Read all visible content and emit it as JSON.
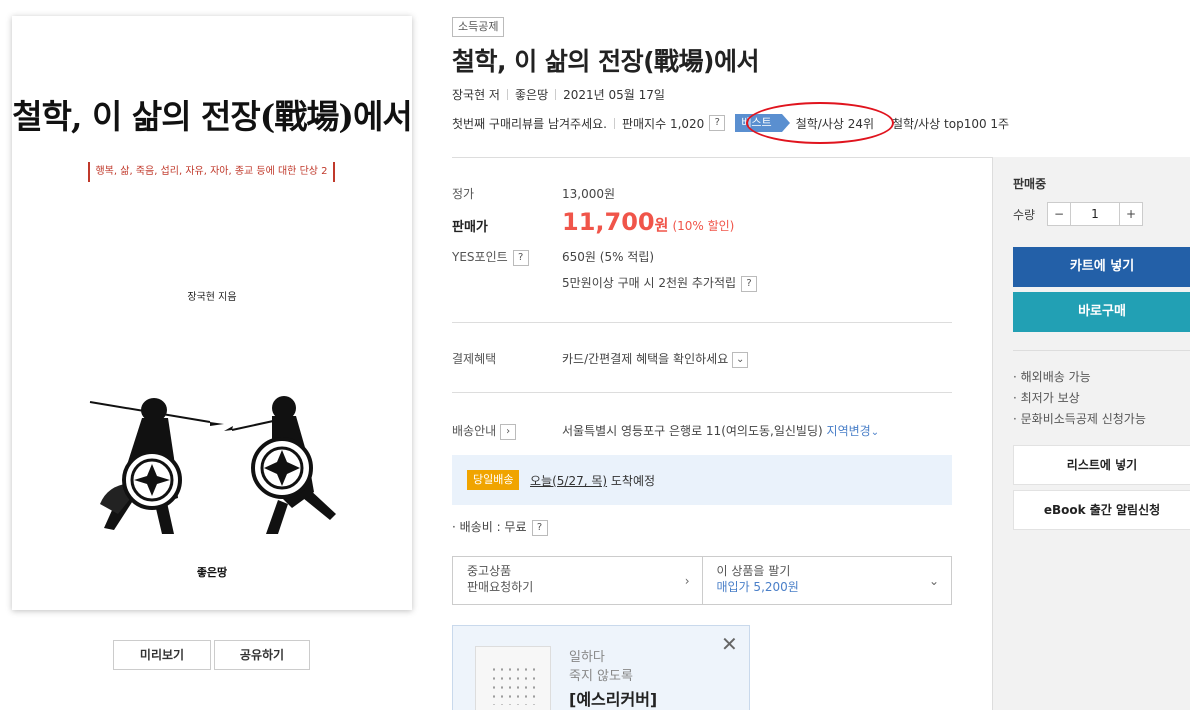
{
  "cover": {
    "title": "철학, 이 삶의 전장(戰場)에서",
    "subtitle": "행복, 삶, 죽음, 섭리, 자유, 자아, 종교 등에 대한 단상 2",
    "author": "장국현 지음",
    "publisher": "좋은땅",
    "preview_label": "미리보기",
    "share_label": "공유하기"
  },
  "product": {
    "tag": "소득공제",
    "title": "철학, 이 삶의 전장(戰場)에서",
    "author": "장국현 저",
    "publisher": "좋은땅",
    "date": "2021년 05월 17일",
    "review_prompt": "첫번째 구매리뷰를 남겨주세요.",
    "sales_index": "판매지수 1,020",
    "best_badge": "베스트",
    "best_rank": "철학/사상 24위",
    "top100": "철학/사상 top100 1주"
  },
  "pricing": {
    "list_label": "정가",
    "list_price": "13,000원",
    "sale_label": "판매가",
    "sale_price": "11,700",
    "sale_unit": "원",
    "discount": "(10% 할인)",
    "points_label": "YES포인트",
    "points": "650원 (5% 적립)",
    "points_extra": "5만원이상 구매 시 2천원 추가적립"
  },
  "payment": {
    "label": "결제혜택",
    "value": "카드/간편결제 혜택을 확인하세요"
  },
  "shipping": {
    "label": "배송안내",
    "address": "서울특별시 영등포구 은행로 11(여의도동,일신빌딩)",
    "change_region": "지역변경",
    "sameday_badge": "당일배송",
    "sameday_date": "오늘(5/27, 목)",
    "sameday_suffix": "도착예정",
    "fee": "· 배송비 : 무료"
  },
  "used": {
    "left_line1": "중고상품",
    "left_line2": "판매요청하기",
    "right_line1": "이 상품을 팔기",
    "right_line2": "매입가 5,200원"
  },
  "ad": {
    "line1": "일하다",
    "line2": "죽지 않도록",
    "line3": "[예스리커버]"
  },
  "sidebar": {
    "status": "판매중",
    "qty_label": "수량",
    "qty_value": "1",
    "minus": "−",
    "plus": "+",
    "cart_label": "카트에 넣기",
    "buy_label": "바로구매",
    "info1": "· 해외배송 가능",
    "info2": "· 최저가 보상",
    "info3": "· 문화비소득공제 신청가능",
    "wishlist_label": "리스트에 넣기",
    "ebook_label": "eBook 출간 알림신청"
  },
  "icons": {
    "question": "?",
    "chevron_right": "›",
    "chevron_down": "⌄",
    "close": "✕"
  },
  "colors": {
    "sale_red": "#f0554a",
    "cart_blue": "#2360a8",
    "buy_teal": "#22a0b4",
    "sameday_orange": "#f0a400",
    "best_blue": "#5a8fd0",
    "highlight_red": "#e0141e"
  }
}
